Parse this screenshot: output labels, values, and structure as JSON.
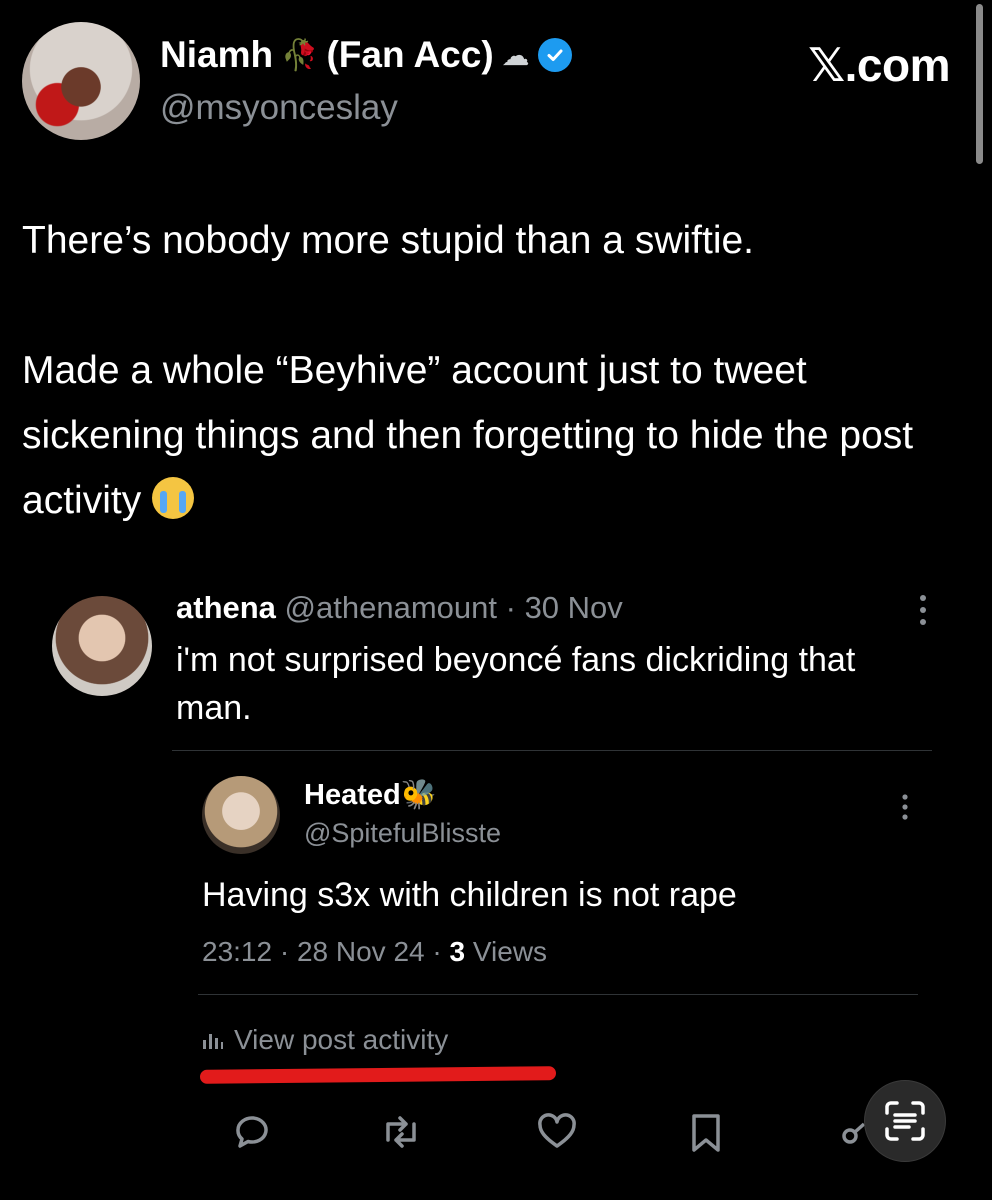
{
  "header": {
    "name": "Niamh",
    "flower_emoji": "🥀",
    "name_suffix": "(Fan Acc)",
    "cloud_emoji": "☁",
    "handle": "@msyonceslay",
    "site": "𝕏.com",
    "verified_color": "#1d9bf0"
  },
  "post": {
    "paragraph1": "There’s nobody more stupid than a swiftie.",
    "paragraph2": "Made a whole “Beyhive” account just to tweet sickening things and then forgetting to hide the post activity",
    "emoji": "loudly-crying-face"
  },
  "quoted": {
    "author_name": "athena",
    "author_handle": "@athenamount",
    "dot": " · ",
    "date": "30 Nov",
    "text": "i'm not surprised beyoncé fans dickriding that man.",
    "reply": {
      "name": "Heated",
      "name_emoji": "🐝",
      "handle": "@SpitefulBlisste",
      "text": "Having s3x with children is not rape",
      "time": "23:12",
      "date": "28 Nov 24",
      "views_count": "3",
      "views_label": "Views",
      "view_activity": "View post activity"
    }
  },
  "actions": [
    "reply-icon",
    "repost-icon",
    "like-icon",
    "bookmark-icon",
    "share-icon"
  ],
  "colors": {
    "background": "#000000",
    "muted": "#8b9096",
    "underline": "#e21b1b"
  }
}
